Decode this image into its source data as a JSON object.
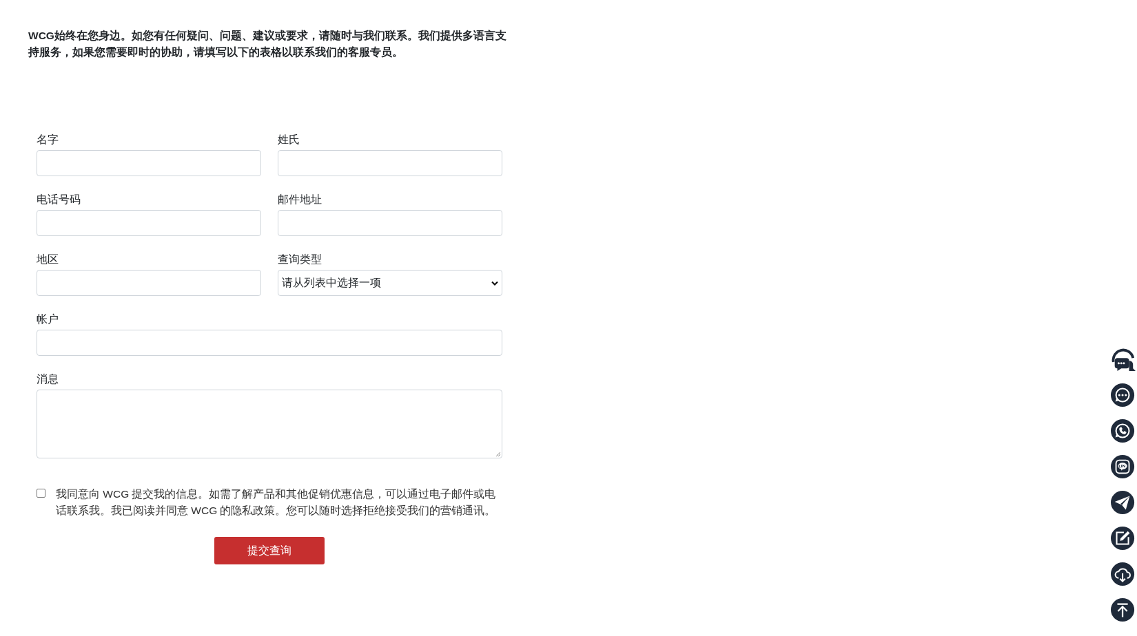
{
  "intro": "WCG始终在您身边。如您有任何疑问、问题、建议或要求，请随时与我们联系。我们提供多语言支持服务，如果您需要即时的协助，请填写以下的表格以联系我们的客服专员。",
  "form": {
    "rows": [
      [
        {
          "label": "名字",
          "kind": "text"
        },
        {
          "label": "姓氏",
          "kind": "text"
        }
      ],
      [
        {
          "label": "电话号码",
          "kind": "text"
        },
        {
          "label": "邮件地址",
          "kind": "text"
        }
      ],
      [
        {
          "label": "地区",
          "kind": "text"
        },
        {
          "label": "查询类型",
          "kind": "select",
          "value": "请从列表中选择一项"
        }
      ],
      [
        {
          "label": "帐户",
          "kind": "text"
        }
      ],
      [
        {
          "label": "消息",
          "kind": "textarea"
        }
      ]
    ],
    "consent": {
      "checked": false,
      "text": "我同意向 WCG 提交我的信息。如需了解产品和其他促销优惠信息，可以通过电子邮件或电话联系我。我已阅读并同意 WCG 的隐私政策。您可以随时选择拒绝接受我们的营销通讯。"
    },
    "submit": "提交查询"
  },
  "side_buttons": [
    {
      "kind": "support"
    },
    {
      "kind": "chat"
    },
    {
      "kind": "whatsapp"
    },
    {
      "kind": "line"
    },
    {
      "kind": "telegram"
    },
    {
      "kind": "edit"
    },
    {
      "kind": "download"
    },
    {
      "kind": "top"
    }
  ]
}
